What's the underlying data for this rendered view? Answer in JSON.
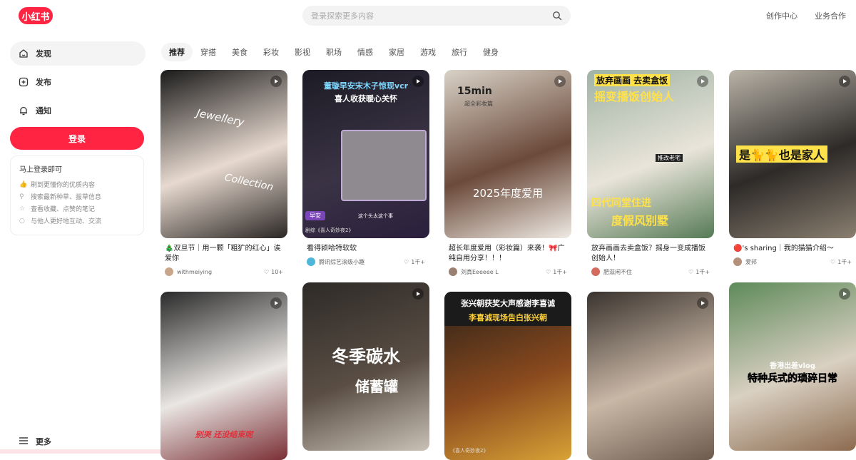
{
  "header": {
    "logo": "小红书",
    "search_placeholder": "登录探索更多内容",
    "links": [
      "创作中心",
      "业务合作"
    ]
  },
  "sidebar": {
    "items": [
      {
        "label": "发现",
        "icon": "home-icon"
      },
      {
        "label": "发布",
        "icon": "plus-square-icon"
      },
      {
        "label": "通知",
        "icon": "bell-icon"
      }
    ],
    "login_button": "登录",
    "login_card": {
      "title": "马上登录即可",
      "rows": [
        "刷到更懂你的优质内容",
        "搜索最新种草、拔草信息",
        "查看收藏、点赞的笔记",
        "与他人更好地互动、交流"
      ]
    },
    "more": "更多"
  },
  "tabs": [
    "推荐",
    "穿搭",
    "美食",
    "彩妆",
    "影视",
    "职场",
    "情感",
    "家居",
    "游戏",
    "旅行",
    "健身"
  ],
  "feed": [
    {
      "caption": "🎄双旦节｜用一颗「粗犷的红心」诶爱你",
      "author": "withmeiying",
      "likes": "10+",
      "overlay": [
        "Jewellery",
        "Collection"
      ],
      "colors": [
        "#1a1a1a",
        "#e7d9cf",
        "#2a2623"
      ]
    },
    {
      "caption": "看得颍哈特软软",
      "author": "腾讯综艺滚级小趣",
      "likes": "1千+",
      "overlay": [
        "董璇早安宋木子惊现vcr",
        "喜人收获暖心关怀",
        "早安",
        "这个头太这个事",
        "剧综《喜人奇妙夜2》"
      ],
      "colors": [
        "#1c1b25",
        "#3a3344",
        "#2a1f3d"
      ]
    },
    {
      "caption": "超长年度爱用（彩妆篇）来袭！🎀广纯自用分享！！！",
      "author": "刘真Eeeeee L",
      "likes": "1千+",
      "overlay": [
        "15min",
        "超全彩妆篇",
        "2025年度爱用"
      ],
      "colors": [
        "#d9d2c8",
        "#6b4a3a",
        "#efeae4"
      ]
    },
    {
      "caption": "放弃画画去卖盒饭？摇身一变成播饭创始人！",
      "author": "肥滋闲不住",
      "likes": "1千+",
      "overlay": [
        "放弃画画 去卖盒饭",
        "摇变播饭创始人",
        "四代同堂住进",
        "度假风别墅",
        "推改老宅"
      ],
      "colors": [
        "#9fb3a4",
        "#e9e4da",
        "#557a55"
      ]
    },
    {
      "caption": "🔴's sharing｜我的猫猫介绍～",
      "author": "爱邦",
      "likes": "1千+",
      "overlay": [
        "是🐈🐈也是家人"
      ],
      "colors": [
        "#b9b3a7",
        "#2d2a28",
        "#8a7f70"
      ]
    },
    {
      "caption": "",
      "author": "",
      "likes": "",
      "overlay": [
        "别哭 还没结束呢"
      ],
      "colors": [
        "#2a2a2a",
        "#e9e6e3",
        "#7a2f35"
      ]
    },
    {
      "caption": "",
      "author": "",
      "likes": "",
      "overlay": [
        "冬季碳水",
        "储蓄罐"
      ],
      "colors": [
        "#2d2a27",
        "#5a4e44",
        "#c9c1b6"
      ]
    },
    {
      "caption": "",
      "author": "",
      "likes": "",
      "overlay": [
        "张兴朝获奖大声感谢李喜诚",
        "李喜诚现场告白张兴朝",
        "《喜人奇妙夜2》"
      ],
      "colors": [
        "#2b2118",
        "#8a4a1e",
        "#d8a236"
      ]
    },
    {
      "caption": "",
      "author": "",
      "likes": "",
      "overlay": [],
      "colors": [
        "#3a332e",
        "#c9b7a6",
        "#6c5a4d"
      ]
    },
    {
      "caption": "",
      "author": "",
      "likes": "",
      "overlay": [
        "香港出差vlog",
        "特种兵式的琐碎日常"
      ],
      "colors": [
        "#5e8a5a",
        "#d9d0c2",
        "#8c6b4f"
      ]
    }
  ],
  "accent": "#ff2442"
}
